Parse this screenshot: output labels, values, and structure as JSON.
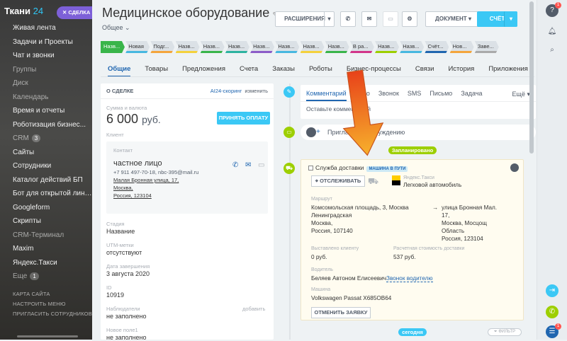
{
  "sidebar": {
    "brand": "Ткани",
    "brand_num": "24",
    "deal_button": "✕ СДЕЛКА",
    "items": [
      {
        "label": "Живая лента",
        "dim": false
      },
      {
        "label": "Задачи и Проекты",
        "dim": false
      },
      {
        "label": "Чат и звонки",
        "dim": false
      },
      {
        "label": "Группы",
        "dim": true
      },
      {
        "label": "Диск",
        "dim": true
      },
      {
        "label": "Календарь",
        "dim": true
      },
      {
        "label": "Время и отчеты",
        "dim": false
      },
      {
        "label": "Роботизация бизнес...",
        "dim": false
      },
      {
        "label": "CRM",
        "dim": true,
        "count": "3"
      },
      {
        "label": "Сайты",
        "dim": false
      },
      {
        "label": "Сотрудники",
        "dim": false
      },
      {
        "label": "Каталог действий БП",
        "dim": false
      },
      {
        "label": "Бот для открытой линии",
        "dim": false
      },
      {
        "label": "Googleform",
        "dim": false
      },
      {
        "label": "Скрипты",
        "dim": false
      },
      {
        "label": "CRM-Терминал",
        "dim": true
      },
      {
        "label": "Maxim",
        "dim": false
      },
      {
        "label": "Яндекс.Такси",
        "dim": false
      },
      {
        "label": "Еще",
        "dim": true,
        "count": "1"
      }
    ],
    "sections": [
      "КАРТА САЙТА",
      "НАСТРОИТЬ МЕНЮ",
      "ПРИГЛАСИТЬ СОТРУДНИКОВ"
    ]
  },
  "header": {
    "title": "Медицинское оборудование",
    "subtitle": "Общее",
    "extensions_button": "РАСШИРЕНИЯ",
    "document_button": "ДОКУМЕНТ",
    "invoice_button": "СЧЁТ"
  },
  "stages": [
    "Назв...",
    "Новая",
    "Подг...",
    "Назв...",
    "Назв...",
    "Назв...",
    "Назв...",
    "Назв...",
    "Назв...",
    "Назв...",
    "В ра...",
    "Назв...",
    "Назв...",
    "Счёт...",
    "Нов...",
    "Заве..."
  ],
  "stage_colors": [
    "#39b54a",
    "#47b8e0",
    "#f4a53c",
    "#f4d13c",
    "#39b54a",
    "#2db3a0",
    "#8c5cc8",
    "#47b8e0",
    "#f4d13c",
    "#39b54a",
    "#d2368a",
    "#9dcf00",
    "#47b8e0",
    "#2066b0",
    "#f4a53c",
    "#aaaaaa"
  ],
  "tabs": [
    "Общие",
    "Товары",
    "Предложения",
    "Счета",
    "Заказы",
    "Роботы",
    "Бизнес-процессы",
    "Связи",
    "История",
    "Приложения"
  ],
  "deal": {
    "section_title": "О СДЕЛКЕ",
    "scoring": "AI24-скоринг",
    "scoring_action": "изменить",
    "amount_label": "Сумма и валюта",
    "amount": "6 000",
    "currency": "руб.",
    "pay_button": "ПРИНЯТЬ ОПЛАТУ",
    "client_label": "Клиент",
    "contact_label": "Контакт",
    "contact_name": "частное лицо",
    "contact_info": "+7 911 497-70-18, nbc-395@mail.ru",
    "address1": "Малая Бронная улица, 17,",
    "address2": "Москва,",
    "address3": "Россия, 123104",
    "stage_label": "Стадия",
    "stage_value": "Название",
    "utm_label": "UTM-метки",
    "utm_value": "отсутствуют",
    "close_date_label": "Дата завершения",
    "close_date_value": "3 августа 2020",
    "id_label": "ID",
    "id_value": "10919",
    "observers_label": "Наблюдатели",
    "observers_action": "добавить",
    "observers_value": "не заполнено",
    "new_field_label": "Новое поле1",
    "new_field_value": "не заполнено"
  },
  "timeline": {
    "tabs": [
      "Комментарий",
      "Дело",
      "Звонок",
      "SMS",
      "Письмо",
      "Задача"
    ],
    "more": "Ещё",
    "comment_placeholder": "Оставьте комментарий",
    "invite": "Пригласить к обсуждению",
    "planned_pill": "Запланировано",
    "today_pill": "сегодня",
    "filter": "ФИЛЬТР"
  },
  "taxi": {
    "title": "Служба доставки",
    "status": "МАШИНА В ПУТИ",
    "track_button": "ОТСЛЕЖИВАТЬ",
    "provider": "Яндекс.Такси",
    "car_type": "Легковой автомобиль",
    "route_label": "Маршрут",
    "from": [
      "Комсомольская площадь, 3, Москва",
      "Ленинградская",
      "Москва,",
      "Россия, 107140"
    ],
    "arrow": "→",
    "to": [
      "улица Бронная Мал.",
      "17,",
      "Москва, Мосцощ",
      "Область",
      "Россия, 123104"
    ],
    "billed_label": "Выставлено клиенту",
    "billed_value": "0 руб.",
    "estimate_label": "Расчетная стоимость доставки",
    "estimate_value": "537 руб.",
    "driver_label": "Водитель",
    "driver_value": "Беляев Автоном Елисеевич",
    "call_driver": "Звонок водителю",
    "car_label": "Машина",
    "car_value": "Volkswagen Passat X685OB64",
    "cancel_button": "ОТМЕНИТЬ ЗАЯВКУ"
  },
  "rail": {
    "help_badge": "1",
    "chat_badge": "1"
  }
}
